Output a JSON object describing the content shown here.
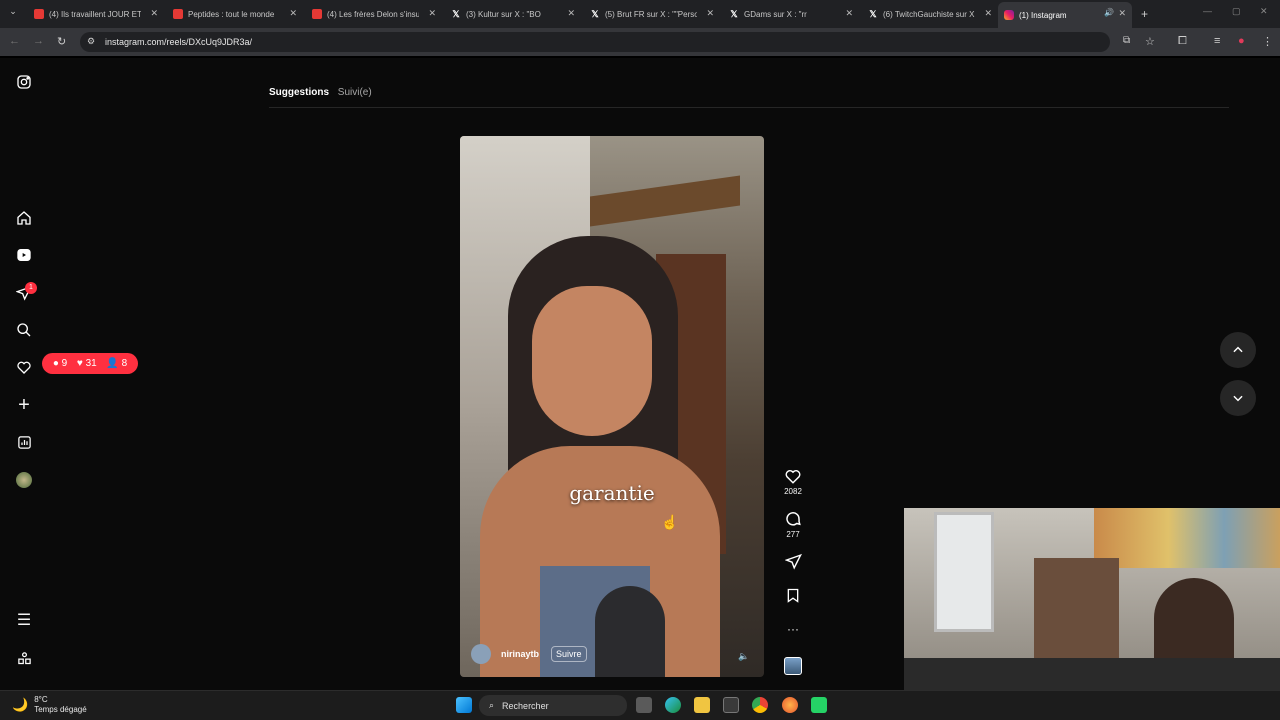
{
  "browser": {
    "tabs": [
      {
        "title": "(4) Ils travaillent JOUR ET",
        "site": "youtube"
      },
      {
        "title": "Peptides : tout le monde",
        "site": "youtube"
      },
      {
        "title": "(4) Les frères Delon s'insu",
        "site": "youtube"
      },
      {
        "title": "(3) Kultur sur X : \"BO",
        "site": "x"
      },
      {
        "title": "(5) Brut FR sur X : \"\"Perso",
        "site": "x"
      },
      {
        "title": "GDams sur X : \"rr",
        "site": "x"
      },
      {
        "title": "(6) TwitchGauchiste sur X",
        "site": "x"
      },
      {
        "title": "(1) Instagram",
        "site": "instagram",
        "active": true
      }
    ],
    "url": "instagram.com/reels/DXcUq9JDR3a/"
  },
  "instagram": {
    "sidebar": {
      "icons": [
        "instagram-logo-icon",
        "home-icon",
        "reels-icon",
        "messages-icon",
        "search-icon",
        "notifications-icon",
        "create-icon",
        "dashboard-icon",
        "profile-avatar",
        "menu-icon",
        "more-icon"
      ],
      "messages_badge": "1",
      "notifications": {
        "comments": "9",
        "likes": "31",
        "followers": "8"
      }
    },
    "tabs": {
      "suggestions": "Suggestions",
      "following": "Suivi(e)"
    },
    "reel": {
      "caption": "garantie",
      "author": "nirinaytb",
      "follow_label": "Suivre",
      "likes": "2082",
      "comments": "277"
    }
  },
  "taskbar": {
    "temperature": "8°C",
    "weather": "Temps dégagé",
    "search_placeholder": "Rechercher"
  },
  "colors": {
    "accent_red": "#ff3040",
    "background": "#0a0a0a"
  }
}
